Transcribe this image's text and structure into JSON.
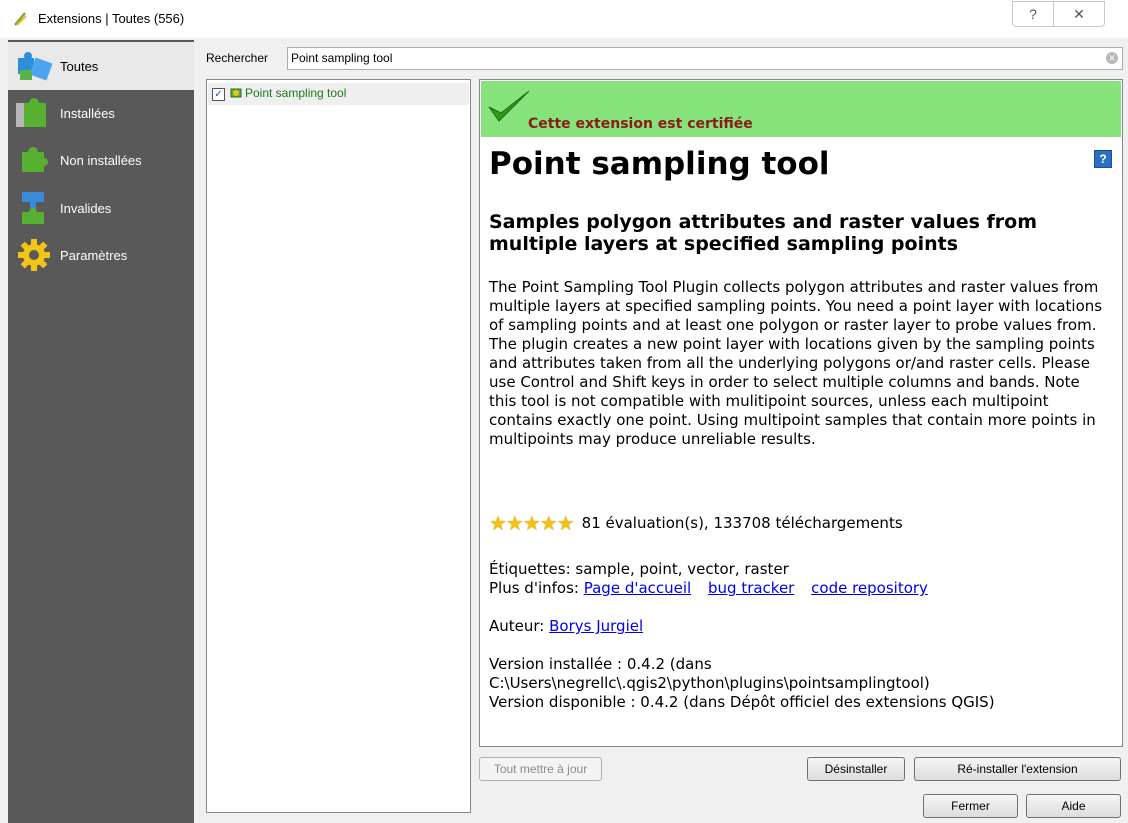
{
  "window": {
    "title": "Extensions | Toutes (556)",
    "help_glyph": "?",
    "close_glyph": "✕"
  },
  "sidebar": {
    "items": [
      {
        "label": "Toutes",
        "icon": "puzzle-blue-icon"
      },
      {
        "label": "Installées",
        "icon": "puzzle-green-icon"
      },
      {
        "label": "Non installées",
        "icon": "puzzle-green-icon"
      },
      {
        "label": "Invalides",
        "icon": "puzzle-invalid-icon"
      },
      {
        "label": "Paramètres",
        "icon": "gear-icon"
      }
    ]
  },
  "search": {
    "label": "Rechercher",
    "value": "Point sampling tool"
  },
  "plugin_list": [
    {
      "name": "Point sampling tool",
      "checked": true
    }
  ],
  "detail": {
    "certified_text": "Cette extension est certifiée",
    "title": "Point sampling tool",
    "subtitle": "Samples polygon attributes and raster values from multiple layers at specified sampling points",
    "description": "The Point Sampling Tool Plugin collects polygon attributes and raster values from multiple layers at specified sampling points. You need a point layer with locations of sampling points and at least one polygon or raster layer to probe values from. The plugin creates a new point layer with locations given by the sampling points and attributes taken from all the underlying polygons or/and raster cells. Please use Control and Shift keys in order to select multiple columns and bands. Note this tool is not compatible with mulitipoint sources, unless each multipoint contains exactly one point. Using multipoint samples that contain more points in multipoints may produce unreliable results.",
    "stars": 5,
    "rating_text": "81 évaluation(s), 133708 téléchargements",
    "tags_text": "Étiquettes: sample, point, vector, raster",
    "more_info_label": "Plus d'infos:",
    "links": [
      "Page d'accueil",
      "bug tracker",
      "code repository"
    ],
    "author_label": "Auteur:",
    "author": "Borys Jurgiel",
    "installed_version": "Version installée : 0.4.2 (dans",
    "installed_path": "C:\\Users\\negrellc\\.qgis2\\python\\plugins\\pointsamplingtool)",
    "available_version": "Version disponible : 0.4.2 (dans Dépôt officiel des extensions QGIS)"
  },
  "buttons": {
    "upgrade_all": "Tout mettre à jour",
    "uninstall": "Désinstaller",
    "reinstall": "Ré-installer l'extension",
    "close": "Fermer",
    "help": "Aide"
  }
}
